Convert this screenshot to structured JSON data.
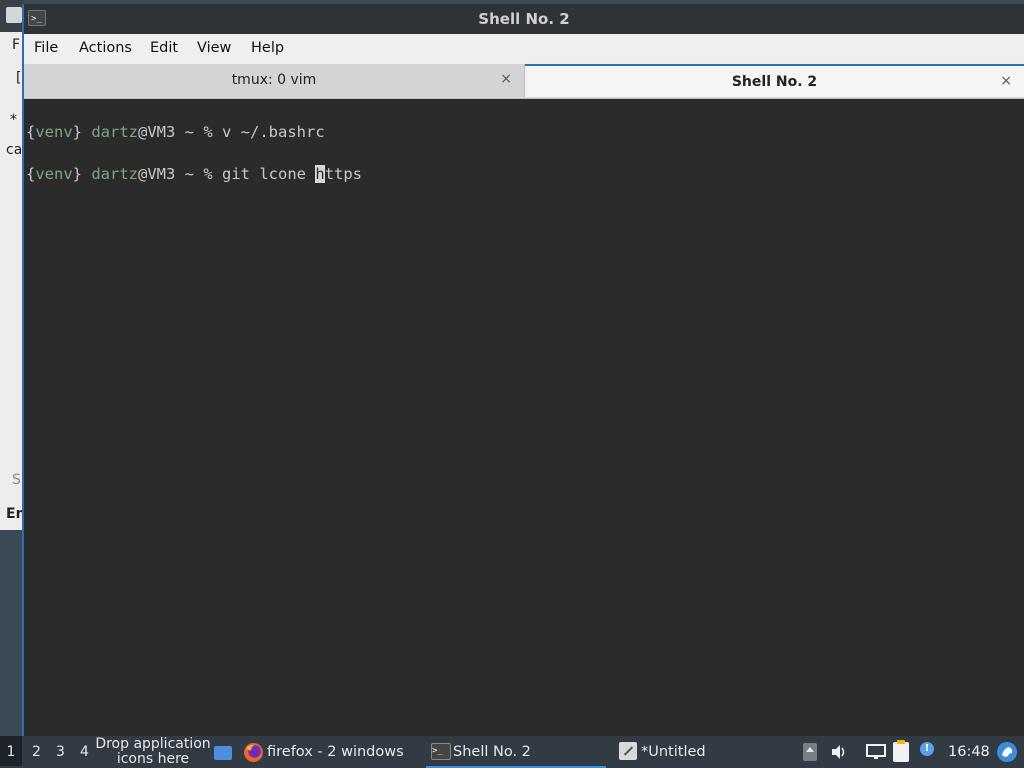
{
  "window": {
    "title": "Shell No. 2"
  },
  "menu": [
    "File",
    "Actions",
    "Edit",
    "View",
    "Help"
  ],
  "tabs": [
    {
      "label": "tmux: 0 vim",
      "active": false
    },
    {
      "label": "Shell No. 2",
      "active": true
    }
  ],
  "close_glyph": "×",
  "terminal": {
    "lines": [
      {
        "venv": "venv",
        "user": "dartz",
        "host": "@VM3 ~ % ",
        "cmd_before": "v ~/.bashrc",
        "cursor": "",
        "cmd_after": ""
      },
      {
        "venv": "venv",
        "user": "dartz",
        "host": "@VM3 ~ % ",
        "cmd_before": "git lcone ",
        "cursor": "h",
        "cmd_after": "ttps"
      }
    ]
  },
  "background_window": {
    "fragments": [
      "F",
      "[",
      "*",
      "ca",
      "S",
      "En"
    ]
  },
  "taskbar": {
    "workspaces": [
      "1",
      "2",
      "3",
      "4"
    ],
    "drop_text": "Drop application icons here",
    "items": [
      {
        "label": "firefox - 2 windows",
        "icon": "firefox-icon"
      },
      {
        "label": "Shell No. 2",
        "icon": "terminal-icon"
      },
      {
        "label": "*Untitled",
        "icon": "text-editor-icon"
      }
    ],
    "clock": "16:48"
  },
  "colors": {
    "accent": "#2d6db4",
    "terminal_bg": "#2b2b2b",
    "prompt_green": "#79a880"
  }
}
